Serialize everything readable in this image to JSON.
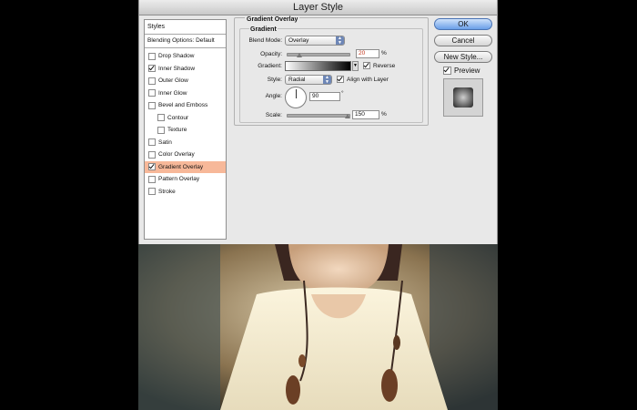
{
  "dialog": {
    "title": "Layer Style"
  },
  "styles_panel": {
    "header": "Styles",
    "blending_options": "Blending Options: Default",
    "items": [
      {
        "label": "Drop Shadow",
        "checked": false,
        "indent": false,
        "selected": false
      },
      {
        "label": "Inner Shadow",
        "checked": true,
        "indent": false,
        "selected": false
      },
      {
        "label": "Outer Glow",
        "checked": false,
        "indent": false,
        "selected": false
      },
      {
        "label": "Inner Glow",
        "checked": false,
        "indent": false,
        "selected": false
      },
      {
        "label": "Bevel and Emboss",
        "checked": false,
        "indent": false,
        "selected": false
      },
      {
        "label": "Contour",
        "checked": false,
        "indent": true,
        "selected": false
      },
      {
        "label": "Texture",
        "checked": false,
        "indent": true,
        "selected": false
      },
      {
        "label": "Satin",
        "checked": false,
        "indent": false,
        "selected": false
      },
      {
        "label": "Color Overlay",
        "checked": false,
        "indent": false,
        "selected": false
      },
      {
        "label": "Gradient Overlay",
        "checked": true,
        "indent": false,
        "selected": true
      },
      {
        "label": "Pattern Overlay",
        "checked": false,
        "indent": false,
        "selected": false
      },
      {
        "label": "Stroke",
        "checked": false,
        "indent": false,
        "selected": false
      }
    ]
  },
  "gradient_overlay": {
    "group_title": "Gradient Overlay",
    "sub_title": "Gradient",
    "blend_mode_label": "Blend Mode:",
    "blend_mode_value": "Overlay",
    "opacity_label": "Opacity:",
    "opacity_value": "20",
    "opacity_unit": "%",
    "gradient_label": "Gradient:",
    "reverse_label": "Reverse",
    "reverse_checked": true,
    "style_label": "Style:",
    "style_value": "Radial",
    "align_label": "Align with Layer",
    "align_checked": true,
    "angle_label": "Angle:",
    "angle_value": "90",
    "angle_unit": "°",
    "scale_label": "Scale:",
    "scale_value": "150",
    "scale_unit": "%"
  },
  "buttons": {
    "ok": "OK",
    "cancel": "Cancel",
    "new_style": "New Style...",
    "preview_label": "Preview",
    "preview_checked": true
  },
  "colors": {
    "selected_row": "#f7b899",
    "default_button": "#6a9fe8"
  }
}
